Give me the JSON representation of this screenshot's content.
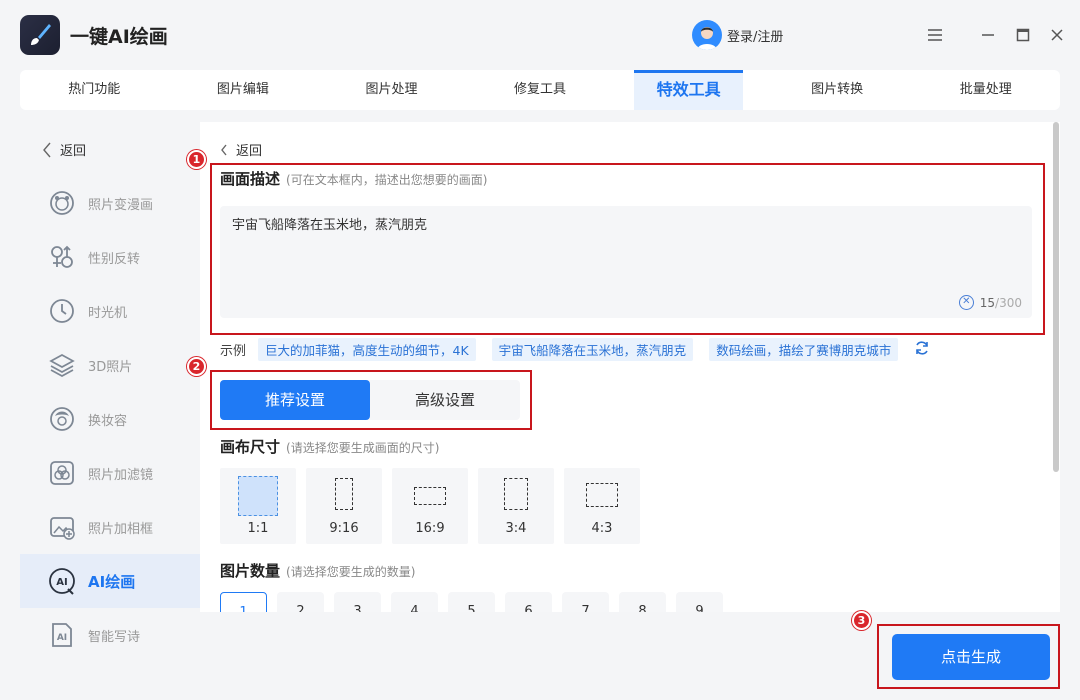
{
  "app": {
    "title": "一键AI绘画",
    "login_label": "登录/注册"
  },
  "tabs": [
    {
      "label": "热门功能"
    },
    {
      "label": "图片编辑"
    },
    {
      "label": "图片处理"
    },
    {
      "label": "修复工具"
    },
    {
      "label": "特效工具",
      "active": true
    },
    {
      "label": "图片转换"
    },
    {
      "label": "批量处理"
    }
  ],
  "sidebar": {
    "back_label": "返回",
    "items": [
      {
        "label": "照片变漫画",
        "icon": "cartoon-face-icon"
      },
      {
        "label": "性别反转",
        "icon": "gender-icon"
      },
      {
        "label": "时光机",
        "icon": "clock-icon"
      },
      {
        "label": "3D照片",
        "icon": "layers-icon"
      },
      {
        "label": "换妆容",
        "icon": "makeup-face-icon"
      },
      {
        "label": "照片加滤镜",
        "icon": "filter-icon"
      },
      {
        "label": "照片加相框",
        "icon": "frame-icon"
      },
      {
        "label": "AI绘画",
        "icon": "ai-paint-icon",
        "active": true
      },
      {
        "label": "智能写诗",
        "icon": "ai-doc-icon"
      }
    ]
  },
  "main": {
    "back_label": "返回",
    "description": {
      "title": "画面描述",
      "hint": "(可在文本框内，描述出您想要的画面)",
      "value": "宇宙飞船降落在玉米地，蒸汽朋克",
      "count": "15",
      "max": "/300"
    },
    "examples": {
      "label": "示例",
      "chips": [
        "巨大的加菲猫，高度生动的细节，4K",
        "宇宙飞船降落在玉米地，蒸汽朋克",
        "数码绘画，描绘了赛博朋克城市"
      ]
    },
    "settings_tabs": [
      "推荐设置",
      "高级设置"
    ],
    "canvas_size": {
      "title": "画布尺寸",
      "hint": "(请选择您要生成画面的尺寸)",
      "options": [
        "1:1",
        "9:16",
        "16:9",
        "3:4",
        "4:3"
      ],
      "selected": "1:1"
    },
    "image_count": {
      "title": "图片数量",
      "hint": "(请选择您要生成的数量)",
      "options": [
        "1",
        "2",
        "3",
        "4",
        "5",
        "6",
        "7",
        "8",
        "9"
      ],
      "selected": "1"
    }
  },
  "generate_label": "点击生成",
  "annotations": [
    "1",
    "2",
    "3"
  ],
  "colors": {
    "accent": "#1f7af5",
    "annotation": "#c8161d"
  }
}
